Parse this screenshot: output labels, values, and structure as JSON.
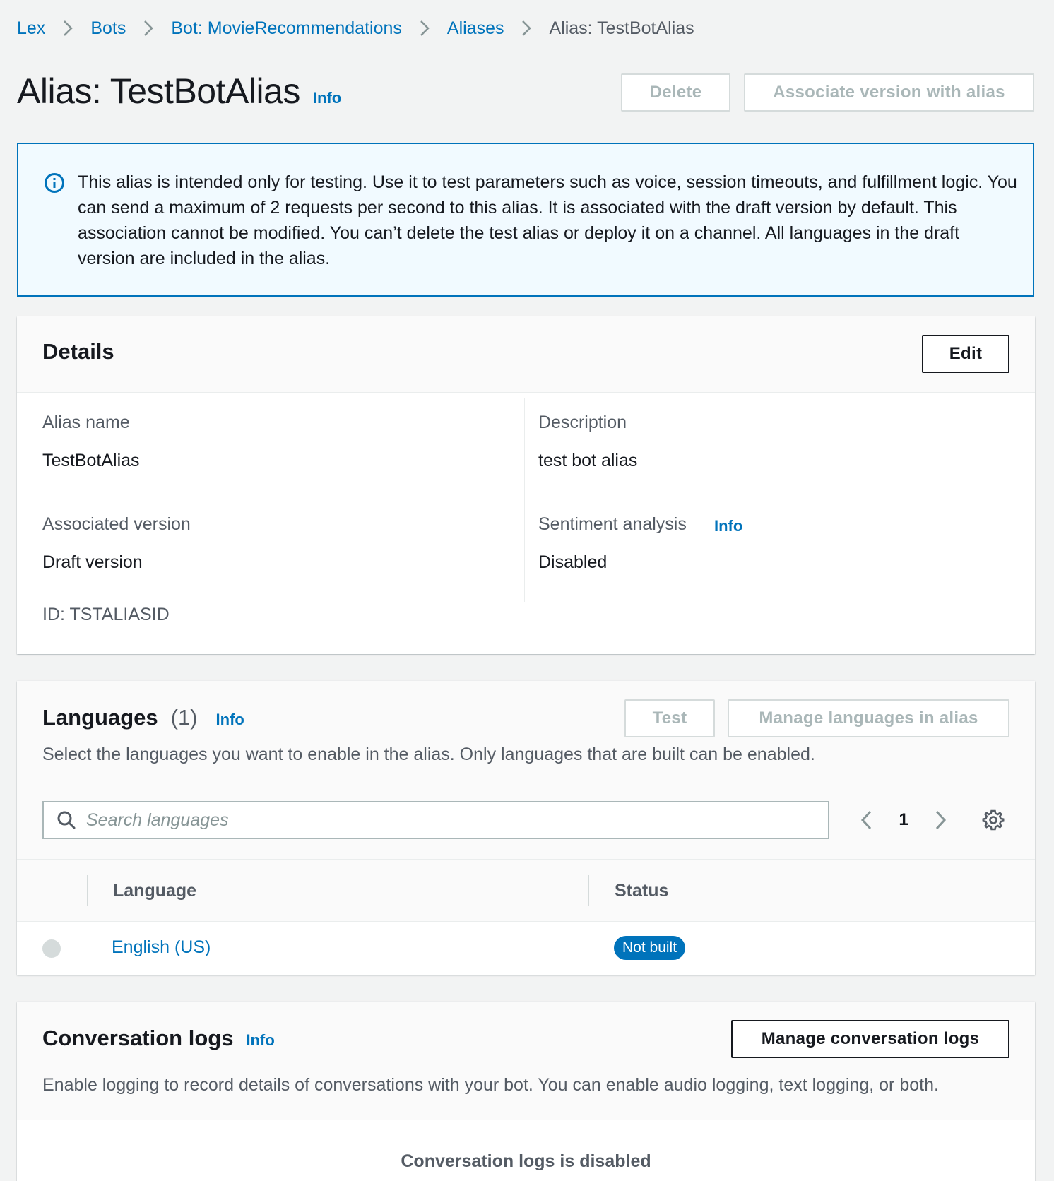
{
  "breadcrumb": {
    "items": [
      "Lex",
      "Bots",
      "Bot: MovieRecommendations",
      "Aliases"
    ],
    "current": "Alias: TestBotAlias"
  },
  "header": {
    "title": "Alias: TestBotAlias",
    "info_label": "Info",
    "delete_label": "Delete",
    "associate_label": "Associate version with alias"
  },
  "alert": {
    "icon": "info-circle-icon",
    "text": "This alias is intended only for testing. Use it to test parameters such as voice, session timeouts, and fulfillment logic. You can send a maximum of 2 requests per second to this alias. It is associated with the draft version by default. This association cannot be modified. You can’t delete the test alias or deploy it on a channel. All languages in the draft version are included in the alias."
  },
  "details": {
    "title": "Details",
    "edit_label": "Edit",
    "alias_name_label": "Alias name",
    "alias_name_value": "TestBotAlias",
    "description_label": "Description",
    "description_value": "test bot alias",
    "associated_version_label": "Associated version",
    "associated_version_value": "Draft version",
    "id_text": "ID: TSTALIASID",
    "sentiment_label": "Sentiment analysis",
    "sentiment_info": "Info",
    "sentiment_value": "Disabled"
  },
  "languages": {
    "title": "Languages",
    "count": "(1)",
    "info_label": "Info",
    "test_label": "Test",
    "manage_label": "Manage languages in alias",
    "description": "Select the languages you want to enable in the alias. Only languages that are built can be enabled.",
    "search_placeholder": "Search languages",
    "page": "1",
    "columns": [
      "Language",
      "Status"
    ],
    "rows": [
      {
        "language": "English (US)",
        "status": "Not built"
      }
    ]
  },
  "conversation_logs": {
    "title": "Conversation logs",
    "info_label": "Info",
    "manage_label": "Manage conversation logs",
    "description": "Enable logging to record details of conversations with your bot. You can enable audio logging, text logging, or both.",
    "empty_text": "Conversation logs is disabled"
  },
  "colors": {
    "link": "#0073bb",
    "background": "#f2f3f3",
    "alert_bg": "#f1faff",
    "badge_bg": "#0073bb"
  }
}
